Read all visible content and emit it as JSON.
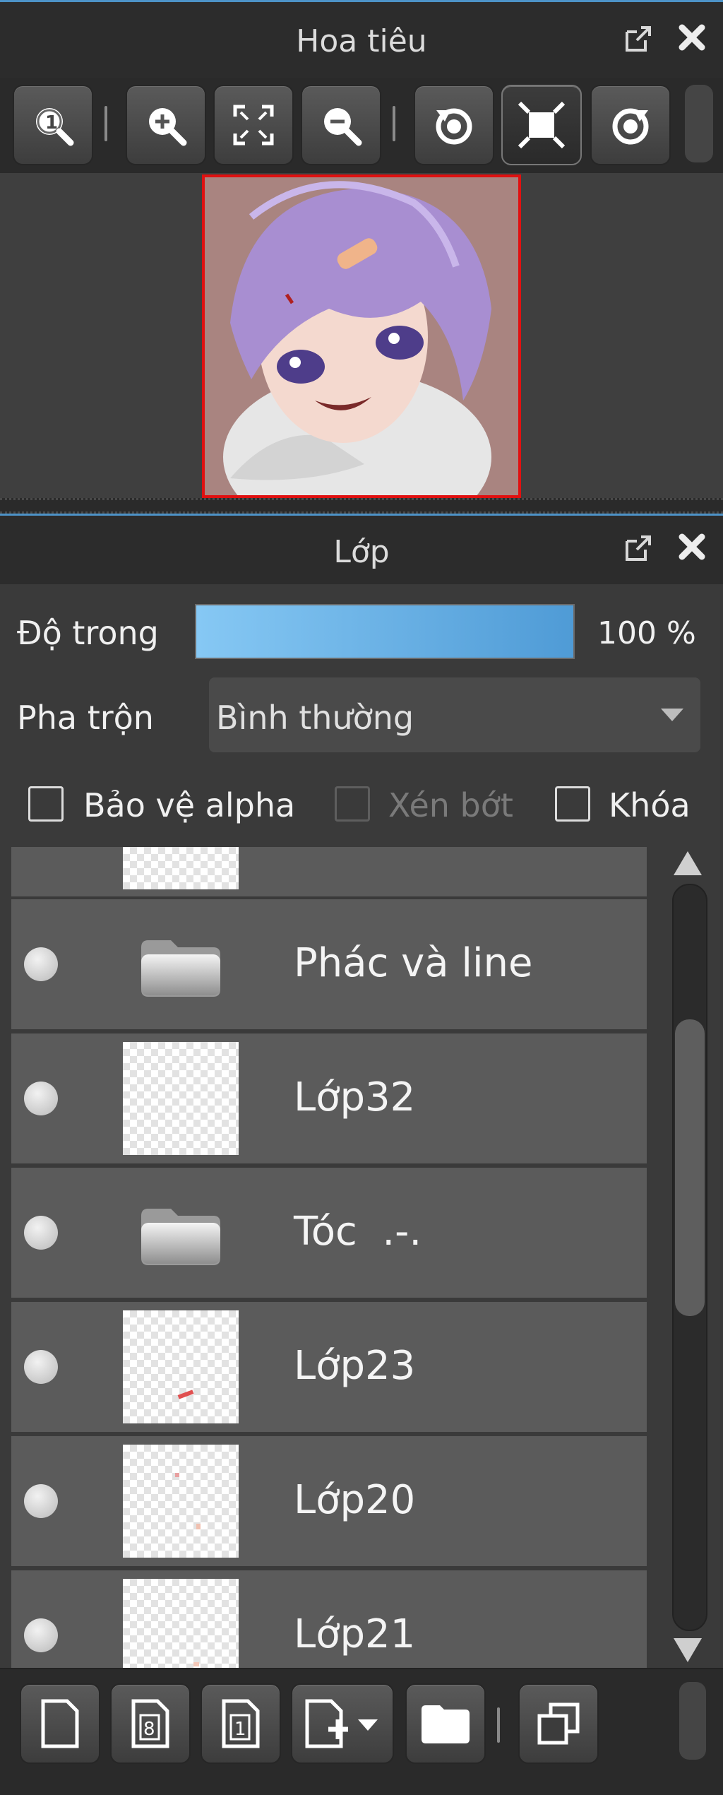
{
  "navigator": {
    "title": "Hoa tiêu",
    "tools": [
      {
        "icon": "zoom-actual-icon"
      },
      {
        "icon": "zoom-in-icon"
      },
      {
        "icon": "fit-to-window-icon"
      },
      {
        "icon": "zoom-out-icon"
      },
      {
        "icon": "rotate-left-icon"
      },
      {
        "icon": "fit-canvas-icon"
      },
      {
        "icon": "rotate-right-icon"
      }
    ]
  },
  "layers": {
    "title": "Lớp",
    "opacity": {
      "label": "Độ trong",
      "value": 100,
      "value_text": "100 %"
    },
    "blend": {
      "label": "Pha trộn",
      "value": "Bình thường"
    },
    "options": {
      "protect_alpha": {
        "label": "Bảo vệ alpha",
        "checked": false
      },
      "clipping": {
        "label": "Xén bớt",
        "checked": false,
        "disabled": true
      },
      "lock": {
        "label": "Khóa",
        "checked": false
      }
    },
    "items": [
      {
        "name": "Phác và line",
        "type": "folder"
      },
      {
        "name": "Lớp32",
        "type": "layer"
      },
      {
        "name": "Tóc  .-.",
        "type": "folder"
      },
      {
        "name": "Lớp23",
        "type": "layer"
      },
      {
        "name": "Lớp20",
        "type": "layer"
      },
      {
        "name": "Lớp21",
        "type": "layer"
      }
    ],
    "bottom_tools": [
      {
        "icon": "new-layer-icon"
      },
      {
        "icon": "new-8bit-layer-icon"
      },
      {
        "icon": "new-1bit-layer-icon"
      },
      {
        "icon": "add-layer-menu-icon"
      },
      {
        "icon": "new-folder-icon"
      },
      {
        "icon": "duplicate-layer-icon"
      }
    ]
  },
  "colors": {
    "accent": "#4d93c8",
    "opacity_bar": "#6fb6ea",
    "selection_border": "#e01010"
  }
}
